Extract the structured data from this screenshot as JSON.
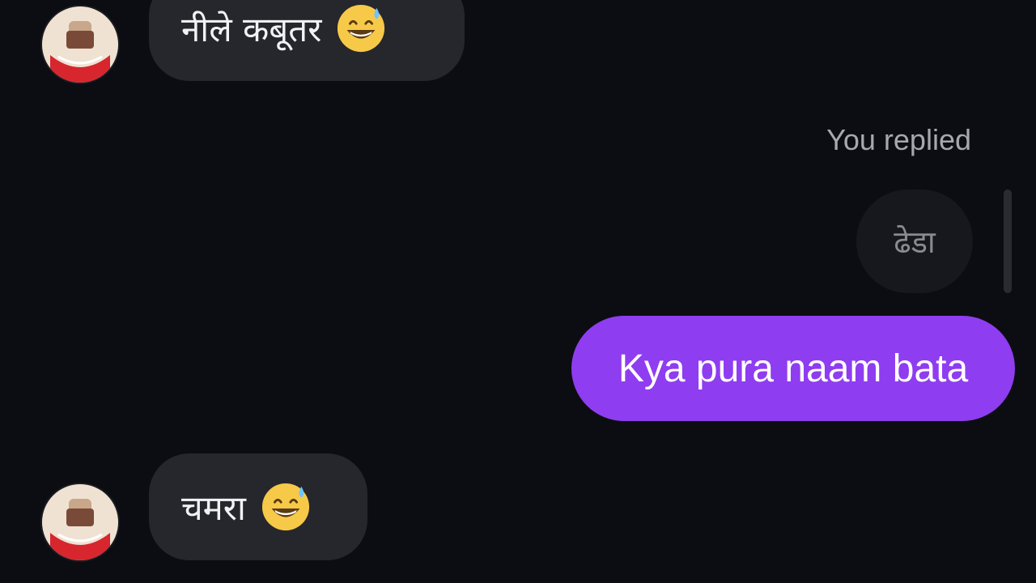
{
  "messages": {
    "top_received": {
      "text": "नीले कबूतर",
      "emoji": "grinning-sweat-emoji"
    },
    "reply_label": "You replied",
    "replied_to_text": "ढेडा",
    "sent": {
      "text": "Kya pura naam bata"
    },
    "bottom_received": {
      "text": "चमरा",
      "emoji": "grinning-sweat-emoji"
    }
  },
  "colors": {
    "background": "#0c0d12",
    "received_bubble": "#26272c",
    "sent_bubble": "#8f3df0",
    "reply_label": "#a7a8ae"
  }
}
